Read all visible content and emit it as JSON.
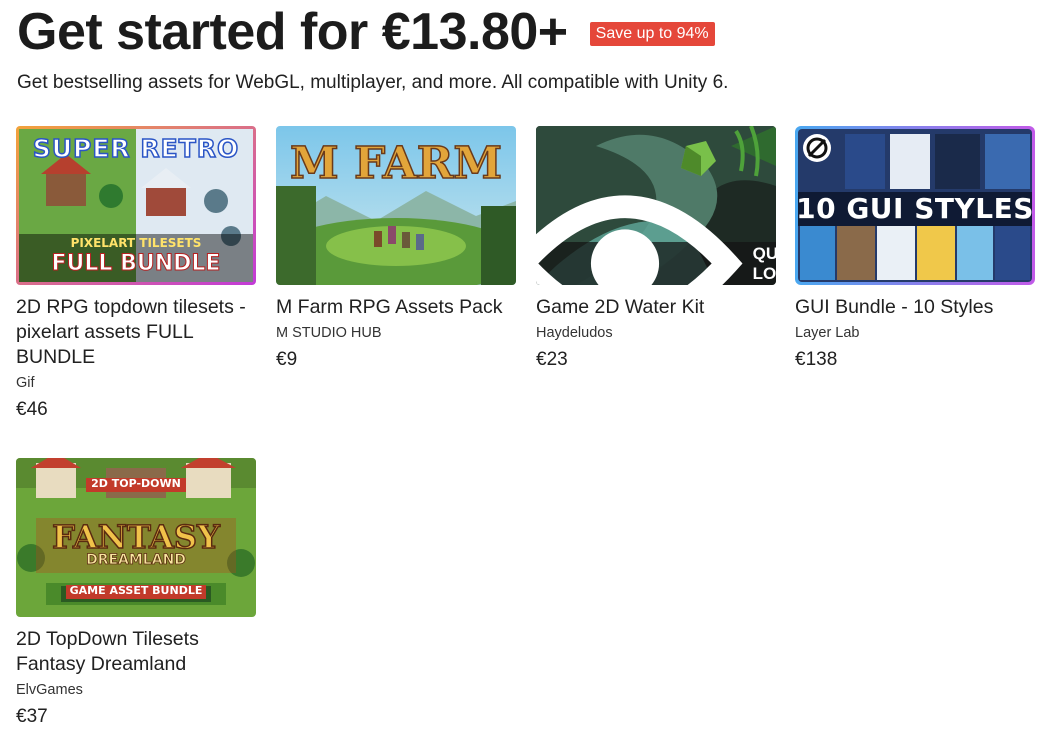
{
  "header": {
    "title": "Get started for €13.80+",
    "badge": "Save up to 94%",
    "subtitle": "Get bestselling assets for WebGL, multiplayer, and more. All compatible with Unity 6."
  },
  "products": [
    {
      "title": "2D RPG topdown tilesets - pixelart assets FULL BUNDLE",
      "publisher": "Gif",
      "price": "€46",
      "art_lines": [
        "SUPER RETRO",
        "PIXELART TILESETS",
        "FULL BUNDLE"
      ]
    },
    {
      "title": "M Farm RPG Assets Pack",
      "publisher": "M STUDIO HUB",
      "price": "€9",
      "art_lines": [
        "M FARM"
      ]
    },
    {
      "title": "Game 2D Water Kit",
      "publisher": "Haydeludos",
      "price": "€23",
      "overlay": "QUICK LOOK"
    },
    {
      "title": "GUI Bundle - 10 Styles",
      "publisher": "Layer Lab",
      "price": "€138",
      "art_lines": [
        "10 GUI STYLES"
      ]
    },
    {
      "title": "2D TopDown Tilesets Fantasy Dreamland",
      "publisher": "ElvGames",
      "price": "€37",
      "art_lines": [
        "2D TOP-DOWN",
        "FANTASY",
        "DREAMLAND",
        "GAME ASSET BUNDLE"
      ]
    }
  ],
  "colors": {
    "badge": "#e5473a",
    "text": "#212121"
  }
}
